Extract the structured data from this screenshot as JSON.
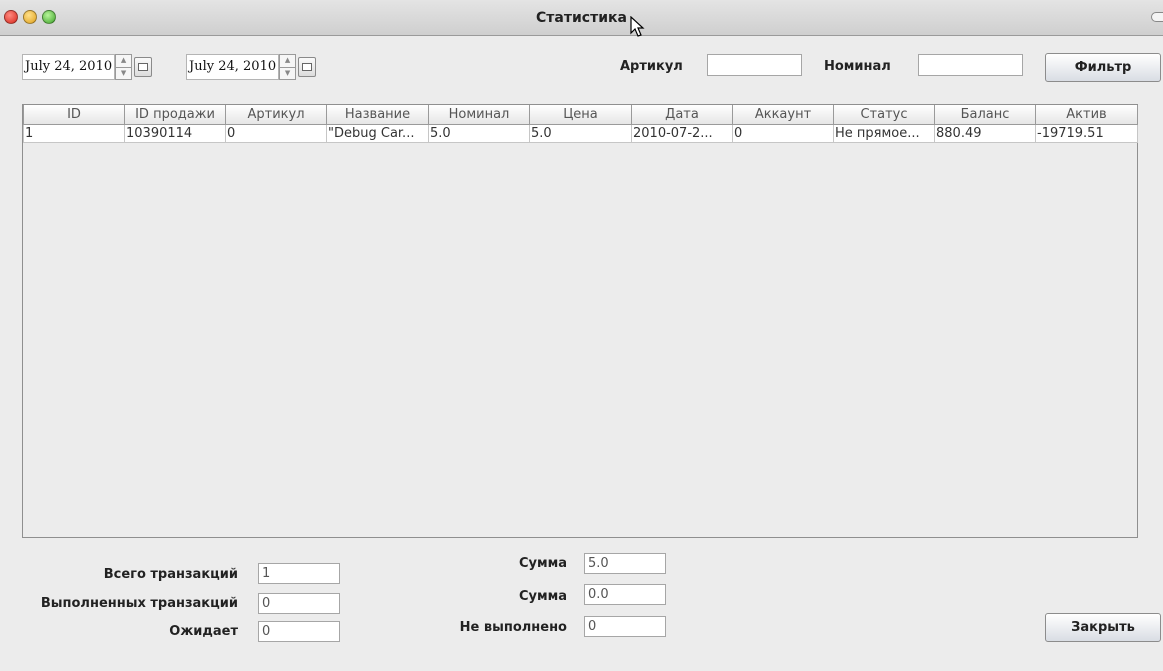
{
  "window": {
    "title": "Статистика"
  },
  "filters": {
    "date_from": "July 24, 2010",
    "date_to": "July 24, 2010",
    "article_label": "Артикул",
    "article_value": "",
    "nominal_label": "Номинал",
    "nominal_value": "",
    "filter_button": "Фильтр"
  },
  "table": {
    "columns": [
      "ID",
      "ID продажи",
      "Артикул",
      "Название",
      "Номинал",
      "Цена",
      "Дата",
      "Аккаунт",
      "Статус",
      "Баланс",
      "Актив"
    ],
    "rows": [
      [
        "1",
        "10390114",
        "0",
        "\"Debug Car...",
        "5.0",
        "5.0",
        "2010-07-2...",
        "0",
        "Не прямое...",
        "880.49",
        "-19719.51"
      ]
    ]
  },
  "summary": {
    "total_label": "Всего транзакций",
    "total_value": "1",
    "completed_label": "Выполненных транзакций",
    "completed_value": "0",
    "pending_label": "Ожидает",
    "pending_value": "0",
    "sum1_label": "Сумма",
    "sum1_value": "5.0",
    "sum2_label": "Сумма",
    "sum2_value": "0.0",
    "not_done_label": "Не выполнено",
    "not_done_value": "0"
  },
  "close_button": "Закрыть",
  "icons": [
    "close-icon",
    "minimize-icon",
    "maximize-icon",
    "calendar-icon",
    "spinner-up-icon",
    "spinner-down-icon",
    "mouse-cursor-icon"
  ]
}
